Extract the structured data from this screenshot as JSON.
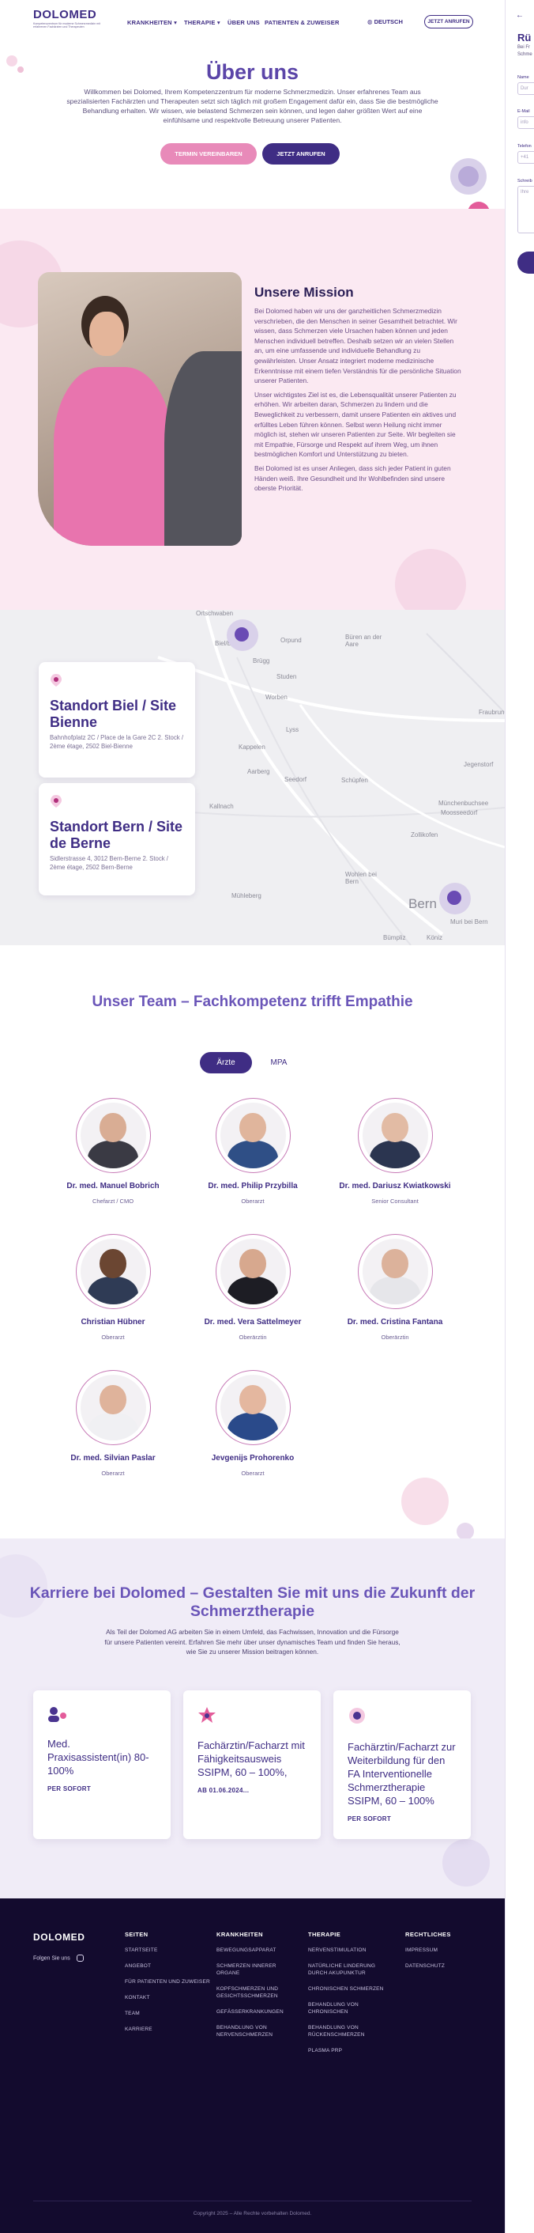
{
  "header": {
    "logo": "DOLOMED",
    "logo_tagline": "Kompetenzzentrum für moderne Schmerzmedizin mit erfahrenen Fachärzten und Therapeuten",
    "nav": [
      "KRANKHEITEN",
      "THERAPIE",
      "ÜBER UNS",
      "PATIENTEN & ZUWEISER"
    ],
    "language": "DEUTSCH",
    "call_button": "JETZT ANRUFEN"
  },
  "hero": {
    "title": "Über uns",
    "intro": "Willkommen bei Dolomed, Ihrem Kompetenzzentrum für moderne Schmerzmedizin. Unser erfahrenes Team aus spezialisierten Fachärzten und Therapeuten setzt sich täglich mit großem Engagement dafür ein, dass Sie die bestmögliche Behandlung erhalten. Wir wissen, wie belastend Schmerzen sein können, und legen daher größten Wert auf eine einfühlsame und respektvolle Betreuung unserer Patienten.",
    "btn_appointment": "TERMIN VEREINBAREN",
    "btn_call": "JETZT ANRUFEN"
  },
  "mission": {
    "title": "Unsere Mission",
    "p1": "Bei Dolomed haben wir uns der ganzheitlichen Schmerzmedizin verschrieben, die den Menschen in seiner Gesamtheit betrachtet. Wir wissen, dass Schmerzen viele Ursachen haben können und jeden Menschen individuell betreffen. Deshalb setzen wir an vielen Stellen an, um eine umfassende und individuelle Behandlung zu gewährleisten. Unser Ansatz integriert moderne medizinische Erkenntnisse mit einem tiefen Verständnis für die persönliche Situation unserer Patienten.",
    "p2": "Unser wichtigstes Ziel ist es, die Lebensqualität unserer Patienten zu erhöhen. Wir arbeiten daran, Schmerzen zu lindern und die Beweglichkeit zu verbessern, damit unsere Patienten ein aktives und erfülltes Leben führen können. Selbst wenn Heilung nicht immer möglich ist, stehen wir unseren Patienten zur Seite. Wir begleiten sie mit Empathie, Fürsorge und Respekt auf ihrem Weg, um ihnen bestmöglichen Komfort und Unterstützung zu bieten.",
    "p3": "Bei Dolomed ist es unser Anliegen, dass sich jeder Patient in guten Händen weiß. Ihre Gesundheit und Ihr Wohlbefinden sind unsere oberste Priorität."
  },
  "map": {
    "places": [
      "Ortschwaben",
      "Biel/Bienne",
      "Orpund",
      "Büren an der Aare",
      "Brügg",
      "Studen",
      "Worben",
      "Lyss",
      "Kappelen",
      "Aarberg",
      "Seedorf",
      "Schüpfen",
      "Münchenbuchsee",
      "Moosseedorf",
      "Jegenstorf",
      "Fraubrunnen",
      "Kallnach",
      "Zollikofen",
      "Wohlen bei Bern",
      "Bern",
      "Muri bei Bern",
      "Mühleberg",
      "Bümpliz",
      "Köniz"
    ],
    "locations": [
      {
        "title": "Standort Biel / Site Bienne",
        "address": "Bahnhofplatz 2C / Place de la Gare 2C 2. Stock / 2ème étage, 2502 Biel-Bienne"
      },
      {
        "title": "Standort Bern / Site de Berne",
        "address": "Sidlerstrasse 4, 3012 Bern-Berne 2. Stock / 2ème étage, 2502 Bern-Berne"
      }
    ]
  },
  "team": {
    "title": "Unser Team – Fachkompetenz trifft Empathie",
    "tabs": [
      "Ärzte",
      "MPA"
    ],
    "members": [
      {
        "name": "Dr. med. Manuel Bobrich",
        "role": "Chefarzt / CMO"
      },
      {
        "name": "Dr. med. Philip Przybilla",
        "role": "Oberarzt"
      },
      {
        "name": "Dr. med. Dariusz Kwiatkowski",
        "role": "Senior Consultant"
      },
      {
        "name": "Christian Hübner",
        "role": "Oberarzt"
      },
      {
        "name": "Dr. med. Vera Sattelmeyer",
        "role": "Oberärztin"
      },
      {
        "name": "Dr. med. Cristina Fantana",
        "role": "Oberärztin"
      },
      {
        "name": "Dr. med. Silvian Paslar",
        "role": "Oberarzt"
      },
      {
        "name": "Jevgenijs Prohorenko",
        "role": "Oberarzt"
      }
    ]
  },
  "career": {
    "title": "Karriere bei Dolomed – Gestalten Sie mit uns die Zukunft der Schmerztherapie",
    "text": "Als Teil der Dolomed AG arbeiten Sie in einem Umfeld, das Fachwissen, Innovation und die Fürsorge für unsere Patienten vereint. Erfahren Sie mehr über unser dynamisches Team und finden Sie heraus, wie Sie zu unserer Mission beitragen können.",
    "jobs": [
      {
        "title": "Med. Praxisassistent(in) 80-100%",
        "link": "PER SOFORT"
      },
      {
        "title": "Fachärztin/Facharzt mit Fähigkeitsausweis SSIPM, 60 – 100%,",
        "link": "AB 01.06.2024..."
      },
      {
        "title": "Fachärztin/Facharzt zur Weiterbildung für den FA Interventionelle Schmerztherapie SSIPM, 60 – 100%",
        "link": "PER SOFORT"
      }
    ]
  },
  "footer": {
    "logo": "DOLOMED",
    "follow": "Folgen Sie uns",
    "columns": [
      {
        "head": "SEITEN",
        "links": [
          "STARTSEITE",
          "ANGEBOT",
          "FÜR PATIENTEN UND ZUWEISER",
          "KONTAKT",
          "TEAM",
          "KARRIERE"
        ]
      },
      {
        "head": "KRANKHEITEN",
        "links": [
          "BEWEGUNGSAPPARAT",
          "SCHMERZEN INNERER ORGANE",
          "KOPFSCHMERZEN UND GESICHTSSCHMERZEN",
          "GEFÄSSERKRANKUNGEN",
          "BEHANDLUNG VON NERVENSCHMERZEN"
        ]
      },
      {
        "head": "THERAPIE",
        "links": [
          "NERVENSTIMULATION",
          "NATÜRLICHE LINDERUNG DURCH AKUPUNKTUR",
          "CHRONISCHEN SCHMERZEN",
          "BEHANDLUNG VON CHRONISCHEN",
          "BEHANDLUNG VON RÜCKENSCHMERZEN",
          "PLASMA PRP"
        ]
      },
      {
        "head": "RECHTLICHES",
        "links": [
          "IMPRESSUM",
          "DATENSCHUTZ"
        ]
      }
    ],
    "copyright": "Copyright 2025 – Alle Rechte vorbehalten Dolomed."
  },
  "side_panel": {
    "title": "Rü",
    "text": [
      "Bei Fr",
      "Schme"
    ],
    "labels": [
      "Name",
      "E-Mail",
      "Telefon",
      "Schreib"
    ],
    "placeholders": [
      "Dur",
      "info",
      "+41",
      "Ihre"
    ]
  },
  "colors": {
    "brand": "#3f2d84",
    "accent": "#e88ab9",
    "mission_bg": "#fbe9f2",
    "footer_bg": "#130b2e"
  }
}
